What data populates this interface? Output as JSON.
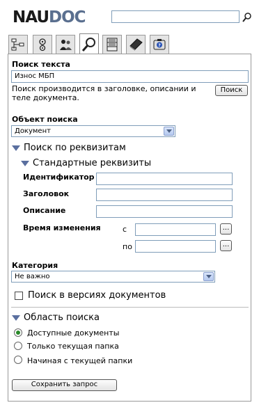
{
  "header": {
    "logo_part1": "NAU",
    "logo_part2": "DOC",
    "search_value": ""
  },
  "tabs": [
    {
      "name": "tab-structure",
      "icon": "structure-icon"
    },
    {
      "name": "tab-workflow",
      "icon": "gears-icon"
    },
    {
      "name": "tab-users",
      "icon": "users-icon"
    },
    {
      "name": "tab-search",
      "icon": "magnifier-icon",
      "active": true
    },
    {
      "name": "tab-archive",
      "icon": "cabinet-icon"
    },
    {
      "name": "tab-books",
      "icon": "book-icon"
    },
    {
      "name": "tab-info",
      "icon": "info-icon"
    }
  ],
  "search": {
    "title": "Поиск текста",
    "query": "Износ МБП",
    "hint": "Поиск производится в заголовке, описании и теле документа.",
    "button": "Поиск"
  },
  "object": {
    "label": "Объект поиска",
    "value": "Документ"
  },
  "attrs": {
    "section": "Поиск по реквизитам",
    "standard": "Стандартные реквизиты",
    "id_label": "Идентификатор",
    "title_label": "Заголовок",
    "desc_label": "Описание",
    "time_label": "Время изменения",
    "from_label": "с",
    "to_label": "по",
    "dots": "..."
  },
  "category": {
    "label": "Категория",
    "value": "Не важно"
  },
  "versions_label": "Поиск в версиях документов",
  "scope": {
    "section": "Область поиска",
    "options": [
      "Доступные документы",
      "Только текущая папка",
      "Начиная с текущей папки"
    ]
  },
  "save_button": "Сохранить запрос"
}
